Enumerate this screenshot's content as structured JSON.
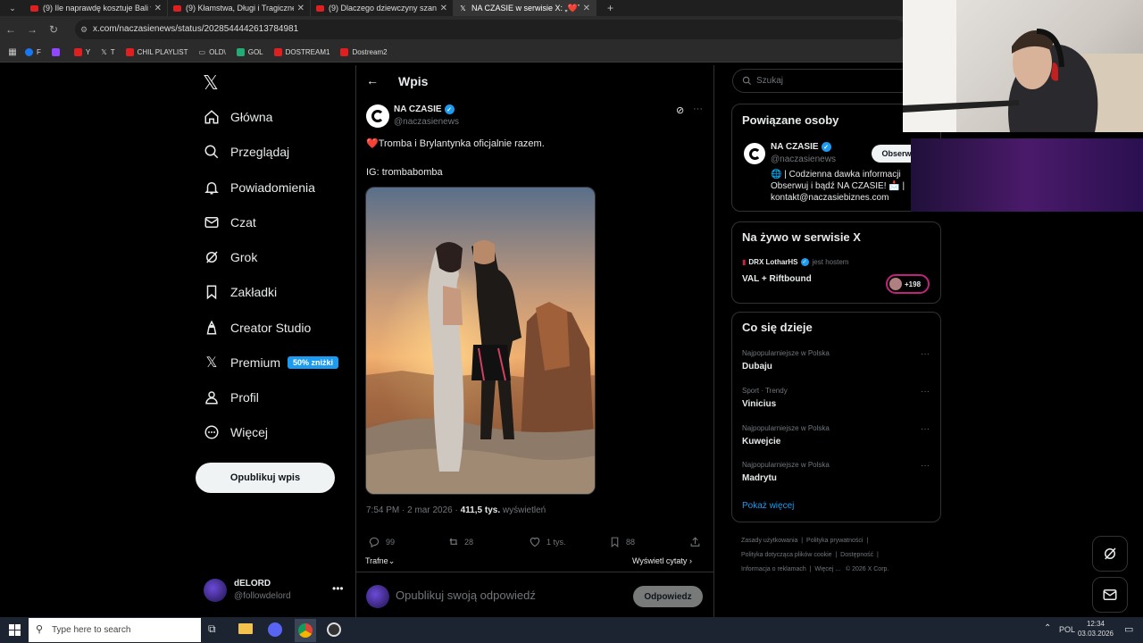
{
  "browser": {
    "tabs": [
      {
        "title": "(9) Ile naprawdę kosztuje Bali w",
        "active": false
      },
      {
        "title": "(9) Kłamstwa, Długi i Tragiczne",
        "active": false
      },
      {
        "title": "(9) Dlaczego dziewczyny szanują",
        "active": false
      },
      {
        "title": "NA CZASIE w serwisie X: „❤️Tromba",
        "active": true
      }
    ],
    "url": "x.com/naczasienews/status/2028544442613784981",
    "bookmarks": [
      "F",
      "Y",
      "T",
      "CHIL PLAYLIST",
      "OLD\\",
      "GOL",
      "DOSTREAM1",
      "Dostream2"
    ]
  },
  "sidebar": {
    "items": [
      {
        "label": "Główna",
        "icon": "home-icon"
      },
      {
        "label": "Przeglądaj",
        "icon": "search-icon"
      },
      {
        "label": "Powiadomienia",
        "icon": "bell-icon"
      },
      {
        "label": "Czat",
        "icon": "mail-icon"
      },
      {
        "label": "Grok",
        "icon": "grok-icon"
      },
      {
        "label": "Zakładki",
        "icon": "bookmark-icon"
      },
      {
        "label": "Creator Studio",
        "icon": "creator-icon"
      },
      {
        "label": "Premium",
        "icon": "x-icon"
      },
      {
        "label": "Profil",
        "icon": "person-icon"
      },
      {
        "label": "Więcej",
        "icon": "more-circle-icon"
      }
    ],
    "premium_badge": "50% zniżki",
    "post_button": "Opublikuj wpis",
    "account": {
      "name": "dELORD",
      "handle": "@followdelord"
    }
  },
  "post": {
    "header_title": "Wpis",
    "author": "NA CZASIE",
    "handle": "@naczasienews",
    "text": "❤️Tromba i Brylantynka oficjalnie razem.",
    "text2": "IG: trombabomba",
    "time": "7:54 PM · 2 mar 2026 · ",
    "views": "411,5 tys.",
    "views_label": " wyświetleń",
    "stats": {
      "replies": "99",
      "reposts": "28",
      "likes": "1 tys.",
      "bookmarks": "88"
    },
    "sort_label": "Trafne",
    "quotes_link": "Wyświetl cytaty",
    "reply_placeholder": "Opublikuj swoją odpowiedź",
    "reply_button": "Odpowiedz"
  },
  "right": {
    "search_placeholder": "Szukaj",
    "related": {
      "title": "Powiązane osoby",
      "name": "NA CZASIE",
      "handle": "@naczasienews",
      "follow": "Obserwuj",
      "bio1": "🌐 | Codzienna dawka informacji",
      "bio2": "Obserwuj i bądź NA CZASIE! 📩 |",
      "bio3": "kontakt@naczasiebiznes.com"
    },
    "live": {
      "title": "Na żywo w serwisie X",
      "host": "DRX LotharHS",
      "host_label": "jest hostem",
      "show": "VAL + Riftbound",
      "count": "+198"
    },
    "trends": {
      "title": "Co się dzieje",
      "items": [
        {
          "cat": "Najpopularniejsze w Polska",
          "name": "Dubaju"
        },
        {
          "cat": "Sport · Trendy",
          "name": "Vinicius"
        },
        {
          "cat": "Najpopularniejsze w Polska",
          "name": "Kuwejcie"
        },
        {
          "cat": "Najpopularniejsze w Polska",
          "name": "Madrytu"
        }
      ],
      "more": "Pokaż więcej"
    },
    "footer": [
      "Zasady użytkowania",
      "Polityka prywatności",
      "Polityka dotycząca plików cookie",
      "Dostępność",
      "Informacja o reklamach",
      "Więcej ...",
      "© 2026 X Corp."
    ]
  },
  "taskbar": {
    "search": "Type here to search",
    "lang": "POL",
    "time": "12:34",
    "date": "03.03.2026"
  },
  "colors": {
    "accent": "#1d9bf0",
    "bg": "#000000",
    "text": "#e7e9ea",
    "muted": "#71767b"
  }
}
